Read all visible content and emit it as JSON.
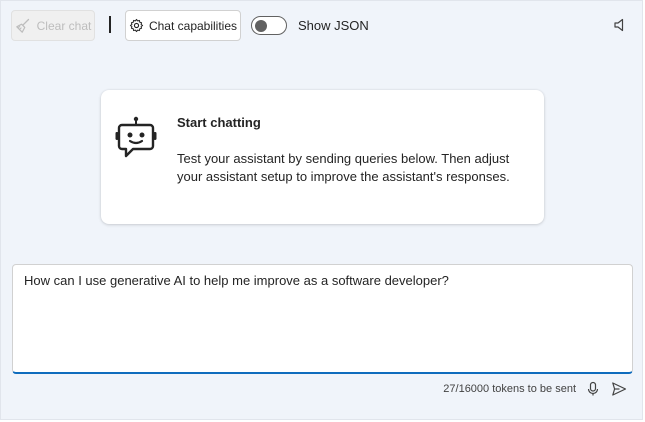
{
  "toolbar": {
    "clear_chat_label": "Clear chat",
    "clear_chat_icon": "broom-icon",
    "chat_capabilities_label": "Chat capabilities",
    "chat_capabilities_icon": "gear-icon",
    "show_json_label": "Show JSON",
    "show_json_enabled": false,
    "speaker_icon": "speaker-icon"
  },
  "card": {
    "icon": "bot-icon",
    "title": "Start chatting",
    "body": "Test your assistant by sending queries below. Then adjust your assistant setup to improve the assistant's responses."
  },
  "prompt": {
    "value": "How can I use generative AI to help me improve as a software developer?",
    "token_status": "27/16000 tokens to be sent",
    "mic_icon": "microphone-icon",
    "send_icon": "send-icon"
  },
  "colors": {
    "accent": "#0f6cbd",
    "background": "#f0f4fa"
  }
}
